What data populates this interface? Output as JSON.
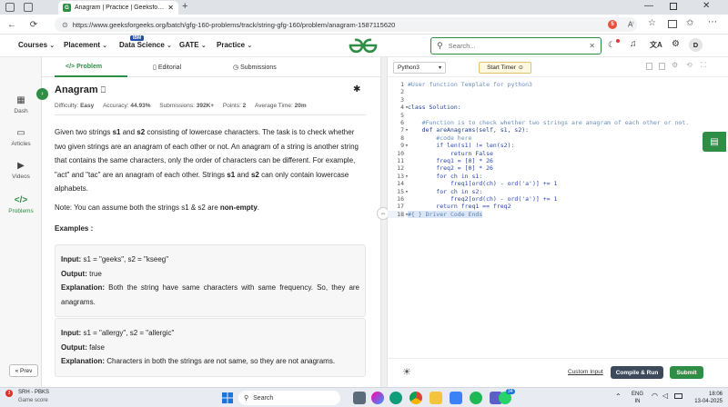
{
  "browser": {
    "tab_title": "Anagram | Practice | GeeksforGeeks",
    "url": "https://www.geeksforgeeks.org/batch/gfg-160-problems/track/string-gfg-160/problem/anagram-1587115620",
    "notification_count": "5"
  },
  "site_nav": {
    "items": [
      "Courses",
      "Placement",
      "Data Science",
      "GATE",
      "Practice"
    ],
    "data_science_badge": "IBM",
    "logo": "GfG",
    "search_placeholder": "Search...",
    "avatar_letter": "D"
  },
  "sidebar": {
    "items": [
      "Dash",
      "Articles",
      "Videos",
      "Problems"
    ],
    "prev_label": "« Prev"
  },
  "problem": {
    "tabs": [
      "Problem",
      "Editorial",
      "Submissions"
    ],
    "title": "Anagram",
    "meta": {
      "difficulty_label": "Difficulty:",
      "difficulty": "Easy",
      "accuracy_label": "Accuracy:",
      "accuracy": "44.93%",
      "submissions_label": "Submissions:",
      "submissions": "392K+",
      "points_label": "Points:",
      "points": "2",
      "time_label": "Average Time:",
      "time": "20m"
    },
    "desc": {
      "p1a": "Given two strings ",
      "s1": "s1",
      "p1b": " and ",
      "s2": "s2",
      "p1c": " consisting of lowercase characters. The task is to check whether two given strings are an anagram of each other or not. An anagram of a string is another string that contains the same characters, only the order of characters can be different. For example, \"act\" and \"tac\" are an anagram of each other. Strings ",
      "p1d": " and ",
      "p1e": " can only contain lowercase alphabets.",
      "note_a": "Note: You can assume both the strings s1 & s2 are ",
      "note_b": "non-empty",
      "note_c": "."
    },
    "examples_heading": "Examples :",
    "examples": [
      {
        "input_label": "Input:",
        "input": " s1 = \"geeks\", s2 = \"kseeg\"",
        "output_label": "Output:",
        "output": " true",
        "expl_label": "Explanation:",
        "expl": " Both the string have same characters with same frequency. So, they are anagrams."
      },
      {
        "input_label": "Input:",
        "input": " s1 = \"allergy\", s2 = \"allergic\"",
        "output_label": "Output:",
        "output": " false",
        "expl_label": "Explanation:",
        "expl": " Characters in both the strings are not same, so they are not anagrams."
      }
    ]
  },
  "editor": {
    "language": "Python3",
    "start_timer": "Start Timer",
    "lines": [
      "#User function Template for python3",
      "",
      "",
      "class Solution:",
      "",
      "    #Function is to check whether two strings are anagram of each other or not.",
      "    def areAnagrams(self, s1, s2):",
      "        #code here",
      "        if len(s1) != len(s2):",
      "            return False",
      "        freq1 = [0] * 26",
      "        freq2 = [0] * 26",
      "        for ch in s1:",
      "            freq1[ord(ch) - ord('a')] += 1",
      "        for ch in s2:",
      "            freq2[ord(ch) - ord('a')] += 1",
      "        return freq1 == freq2",
      "#{ } Driver Code Ends"
    ],
    "custom_input": "Custom Input",
    "compile_run": "Compile & Run",
    "submit": "Submit"
  },
  "taskbar": {
    "weather_badge": "3",
    "weather_title": "SRH - PBKS",
    "weather_sub": "Game score",
    "search_label": "Search",
    "whatsapp_badge": "34",
    "lang1": "ENG",
    "lang2": "IN",
    "time": "18:06",
    "date": "13-04-2025"
  }
}
